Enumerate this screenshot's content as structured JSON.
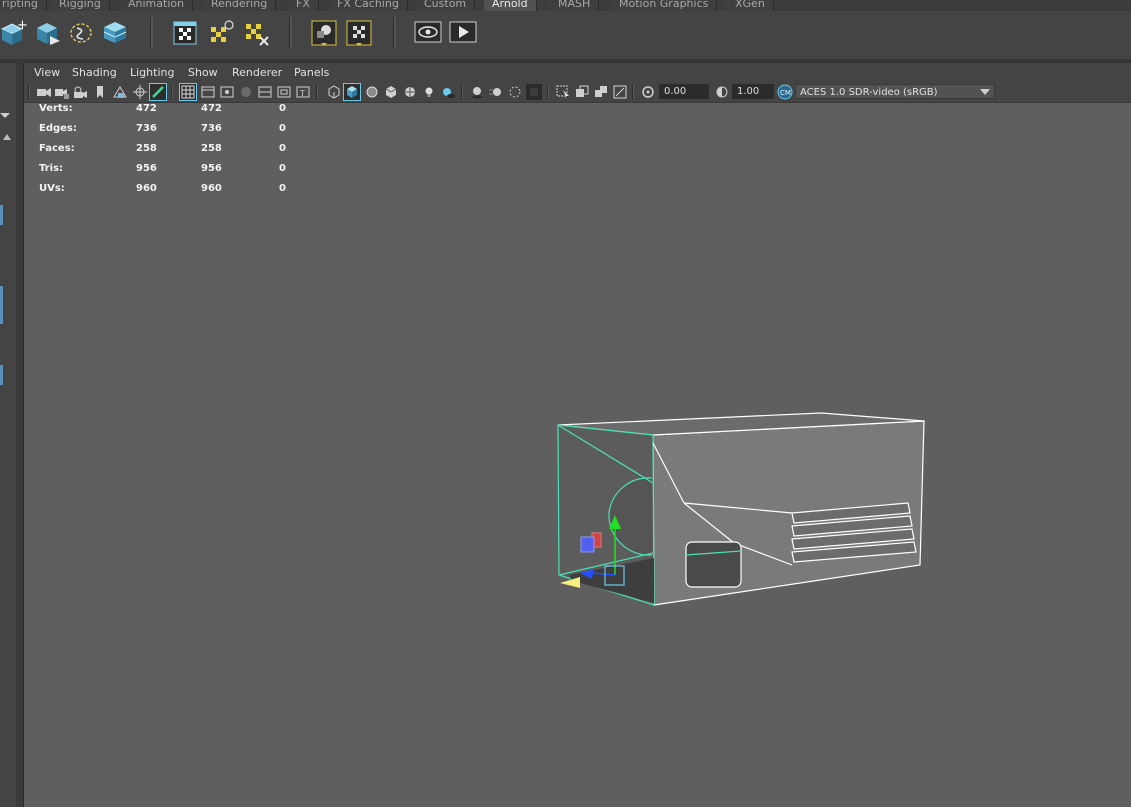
{
  "shelf_tabs": [
    {
      "label": "ripting",
      "active": false
    },
    {
      "label": "Rigging",
      "active": false
    },
    {
      "label": "Animation",
      "active": false
    },
    {
      "label": "Rendering",
      "active": false
    },
    {
      "label": "FX",
      "active": false
    },
    {
      "label": "FX Caching",
      "active": false
    },
    {
      "label": "Custom",
      "active": false
    },
    {
      "label": "Arnold",
      "active": true
    },
    {
      "label": "MASH",
      "active": false
    },
    {
      "label": "Motion Graphics",
      "active": false
    },
    {
      "label": "XGen",
      "active": false
    }
  ],
  "shelf_icons": [
    "create-cube-icon",
    "export-cube-icon",
    "lasso-select-icon",
    "layered-cube-icon",
    "checker-window-icon",
    "checker-light-icon",
    "checker-delete-icon",
    "aov-sphere-icon",
    "checker-arrow-icon",
    "eye-render-view-icon",
    "play-render-icon"
  ],
  "panel": {
    "menus": [
      "View",
      "Shading",
      "Lighting",
      "Show",
      "Renderer",
      "Panels"
    ],
    "exposure": "0.00",
    "gamma": "1.00",
    "color_space": "ACES 1.0 SDR-video (sRGB)"
  },
  "hud": {
    "rows": [
      {
        "label": "Verts:",
        "a": "472",
        "b": "472",
        "c": "0"
      },
      {
        "label": "Edges:",
        "a": "736",
        "b": "736",
        "c": "0"
      },
      {
        "label": "Faces:",
        "a": "258",
        "b": "258",
        "c": "0"
      },
      {
        "label": "Tris:",
        "a": "956",
        "b": "956",
        "c": "0"
      },
      {
        "label": "UVs:",
        "a": "960",
        "b": "960",
        "c": "0"
      }
    ]
  },
  "colors": {
    "active_tab": "#525252",
    "viewport_bg": "#5f5f5f",
    "selection_highlight": "#49e0b5",
    "accent_blue": "#5a8fbe",
    "gizmo_y": "#22e022",
    "gizmo_x": "#e04040",
    "gizmo_z": "#2050ff",
    "gizmo_light": "#f5f080"
  }
}
